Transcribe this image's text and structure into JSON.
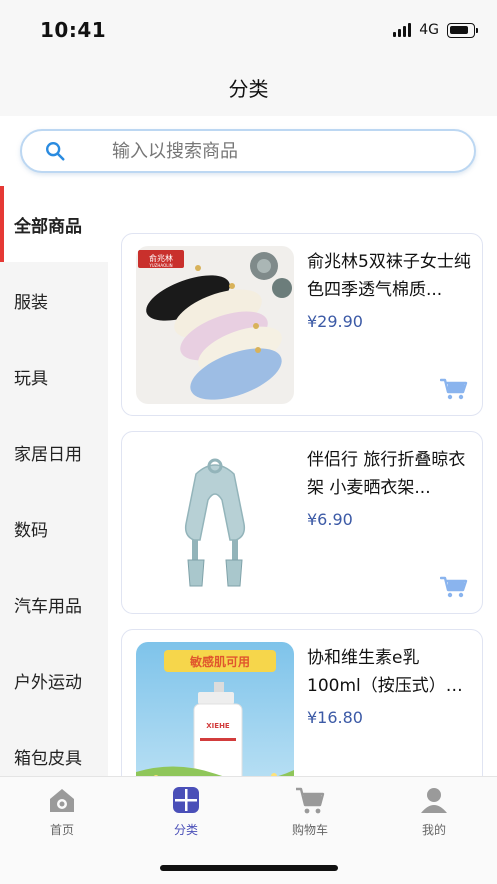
{
  "status_bar": {
    "time": "10:41",
    "network": "4G"
  },
  "nav": {
    "title": "分类"
  },
  "search": {
    "placeholder": "输入以搜索商品",
    "icon": "search-icon"
  },
  "sidebar": {
    "items": [
      {
        "label": "全部商品",
        "active": true
      },
      {
        "label": "服装"
      },
      {
        "label": "玩具"
      },
      {
        "label": "家居日用"
      },
      {
        "label": "数码"
      },
      {
        "label": "汽车用品"
      },
      {
        "label": "户外运动"
      },
      {
        "label": "箱包皮具"
      }
    ]
  },
  "products": [
    {
      "name": "俞兆林5双袜子女士纯色四季透气棉质...",
      "price": "¥29.90",
      "brand_text": "俞兆林",
      "brand_sub": "YUZHAOLIN"
    },
    {
      "name": "伴侣行 旅行折叠晾衣架 小麦晒衣架...",
      "price": "¥6.90"
    },
    {
      "name": "协和维生素e乳100ml（按压式）全家...",
      "price": "¥16.80",
      "banner_text": "敏感肌可用",
      "bottle_text": "XIEHE"
    }
  ],
  "tabbar": {
    "items": [
      {
        "label": "首页",
        "icon": "home-icon"
      },
      {
        "label": "分类",
        "icon": "category-icon",
        "active": true
      },
      {
        "label": "购物车",
        "icon": "cart-icon"
      },
      {
        "label": "我的",
        "icon": "user-icon"
      }
    ]
  },
  "colors": {
    "accent": "#4a4fb8",
    "price": "#3c5aa6",
    "active_indicator": "#e53935",
    "cart_icon": "#8ab4ee"
  }
}
